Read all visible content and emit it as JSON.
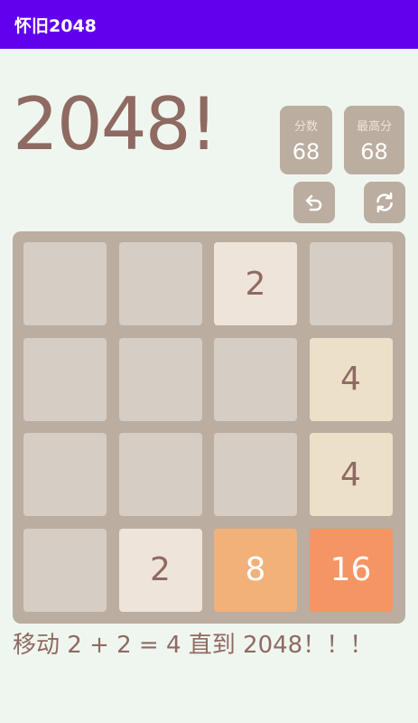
{
  "app": {
    "title": "怀旧2048"
  },
  "game": {
    "title": "2048!",
    "score_label": "分数",
    "score_value": "68",
    "best_label": "最高分",
    "best_value": "68",
    "message": "移动 2 + 2 = 4 直到 2048！！！"
  },
  "icons": {
    "undo": "undo-icon",
    "restart": "refresh-icon"
  },
  "colors": {
    "appbar": "#6200ee",
    "background": "#eff6ef",
    "board": "#bbada0",
    "empty": "#d6cdc4",
    "t2": "#eee4da",
    "t4": "#ede0c8",
    "t8": "#f2b179",
    "t16": "#f59563"
  },
  "board": [
    [
      "",
      "",
      "2",
      ""
    ],
    [
      "",
      "",
      "",
      "4"
    ],
    [
      "",
      "",
      "",
      "4"
    ],
    [
      "",
      "2",
      "8",
      "16"
    ]
  ]
}
